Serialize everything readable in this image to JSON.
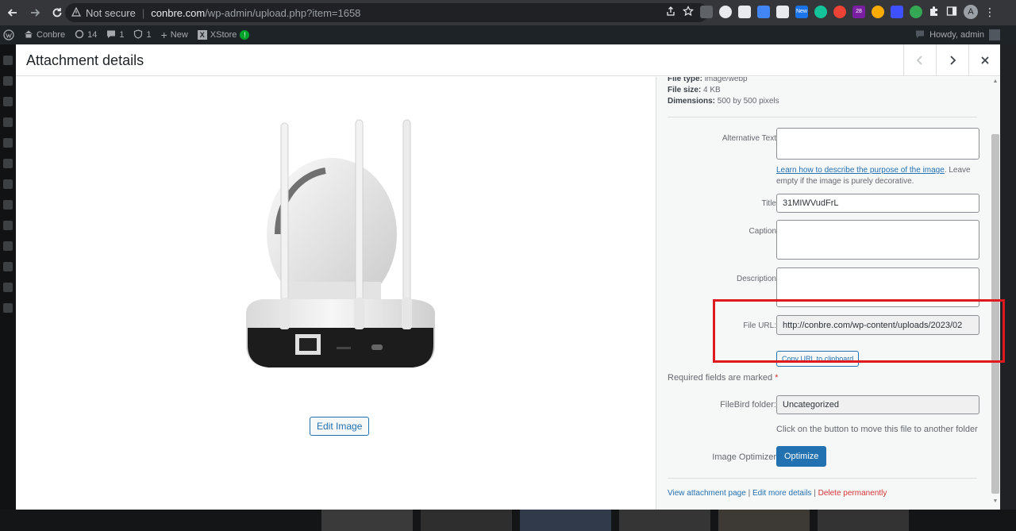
{
  "browser": {
    "security_label": "Not secure",
    "url_domain": "conbre.com",
    "url_path": "/wp-admin/upload.php?item=1658",
    "new_badge": "New",
    "ext_count": "28",
    "avatar_letter": "A"
  },
  "adminbar": {
    "site_name": "Conbre",
    "updates_count": "14",
    "comments_count": "1",
    "shield_count": "1",
    "new_label": "New",
    "xstore_label": "XStore",
    "xstore_badge": "!",
    "howdy": "Howdy, admin"
  },
  "modal": {
    "title": "Attachment details",
    "prev_icon": "chevron-left-icon",
    "next_icon": "chevron-right-icon",
    "close_icon": "close-icon",
    "edit_image_label": "Edit Image"
  },
  "details": {
    "file_type_label": "File type:",
    "file_type": "image/webp",
    "file_size_label": "File size:",
    "file_size": "4 KB",
    "dimensions_label": "Dimensions:",
    "dimensions": "500 by 500 pixels",
    "alt_text_label": "Alternative Text",
    "alt_text_value": "",
    "alt_help_link": "Learn how to describe the purpose of the image",
    "alt_help_text": ". Leave empty if the image is purely decorative.",
    "title_label": "Title",
    "title_value": "31MIWVudFrL",
    "caption_label": "Caption",
    "caption_value": "",
    "description_label": "Description",
    "description_value": "",
    "file_url_label": "File URL:",
    "file_url_value": "http://conbre.com/wp-content/uploads/2023/02",
    "copy_url_label": "Copy URL to clipboard",
    "required_text": "Required fields are marked",
    "required_star": "*",
    "filebird_label": "FileBird folder:",
    "filebird_value": "Uncategorized",
    "filebird_help": "Click on the button to move this file to another folder",
    "optimizer_label": "Image Optimizer",
    "optimize_button": "Optimize",
    "view_attachment": "View attachment page",
    "edit_more": "Edit more details",
    "delete_permanently": "Delete permanently",
    "action_sep": "|"
  },
  "colors": {
    "accent": "#2271b1",
    "danger": "#d63638",
    "highlight": "#e0191e"
  }
}
